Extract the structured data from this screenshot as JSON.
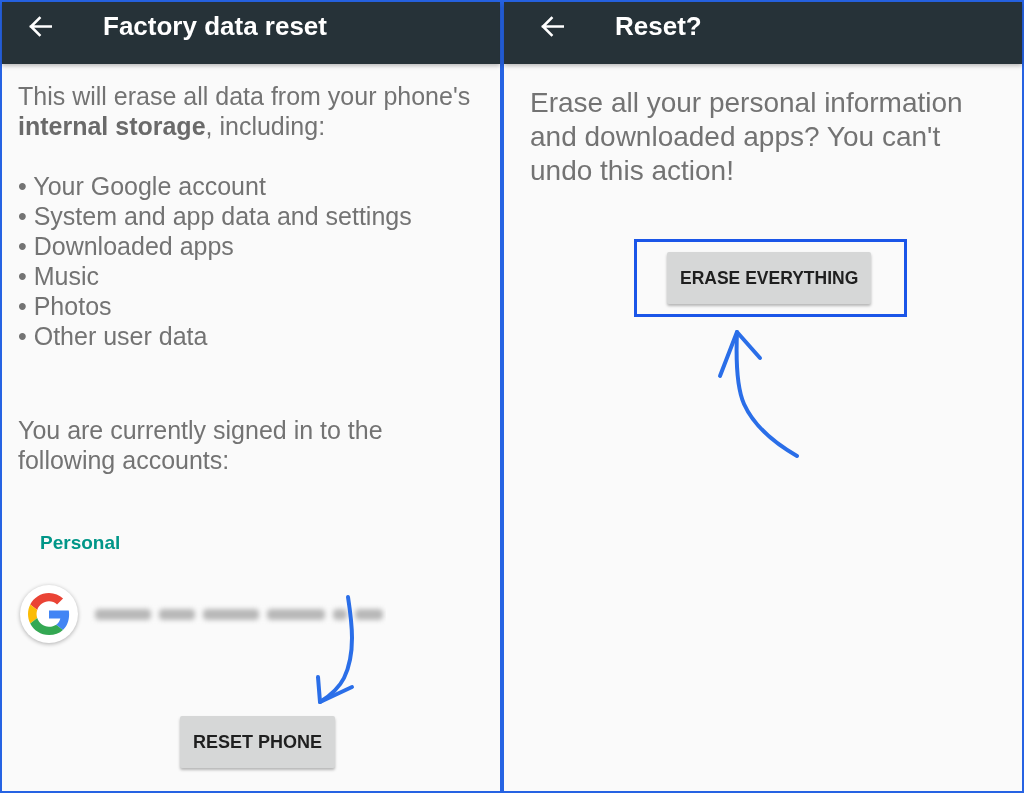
{
  "panels": [
    {
      "kind": "info",
      "title": "Factory data reset",
      "intro": "This will erase all data from your phone's **internal storage**, including:",
      "items": [
        "• Your Google account",
        "• System and app data and settings",
        "• Downloaded apps",
        "• Music",
        "• Photos",
        "• Other user data"
      ],
      "accounts_note": "You are currently signed in to the following accounts:",
      "account_group": "Personal",
      "account": {
        "kind": "google"
      },
      "button": {
        "label": "RESET PHONE",
        "highlighted": false,
        "arrow": true
      }
    },
    {
      "kind": "confirm",
      "title": "Reset?",
      "message": "Erase all your personal information and downloaded apps? You can't undo this action!",
      "button": {
        "label": "ERASE EVERYTHING",
        "highlighted": true,
        "arrow": true
      }
    }
  ]
}
